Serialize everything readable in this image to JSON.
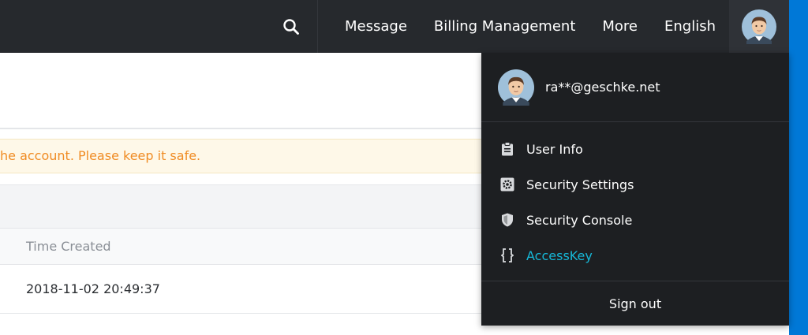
{
  "header": {
    "search_icon": "search-icon",
    "nav": [
      {
        "label": "Message"
      },
      {
        "label": "Billing Management"
      },
      {
        "label": "More"
      },
      {
        "label": "English"
      }
    ],
    "avatar_icon": "avatar-icon"
  },
  "main": {
    "alert_text": "he account. Please keep it safe.",
    "table": {
      "columns": [
        "Time Created"
      ],
      "rows": [
        [
          "2018-11-02 20:49:37"
        ]
      ]
    }
  },
  "user_menu": {
    "email": "ra**@geschke.net",
    "items": [
      {
        "label": "User Info",
        "icon": "clipboard-icon"
      },
      {
        "label": "Security Settings",
        "icon": "gear-icon"
      },
      {
        "label": "Security Console",
        "icon": "shield-icon"
      },
      {
        "label": "AccessKey",
        "icon": "accesskey-icon"
      }
    ],
    "sign_out": "Sign out"
  },
  "colors": {
    "topbar": "#26292d",
    "dropdown": "#1d1f22",
    "accent": "#16b8d8",
    "alert_text": "#f08c24",
    "alert_bg": "#fef8e8"
  }
}
